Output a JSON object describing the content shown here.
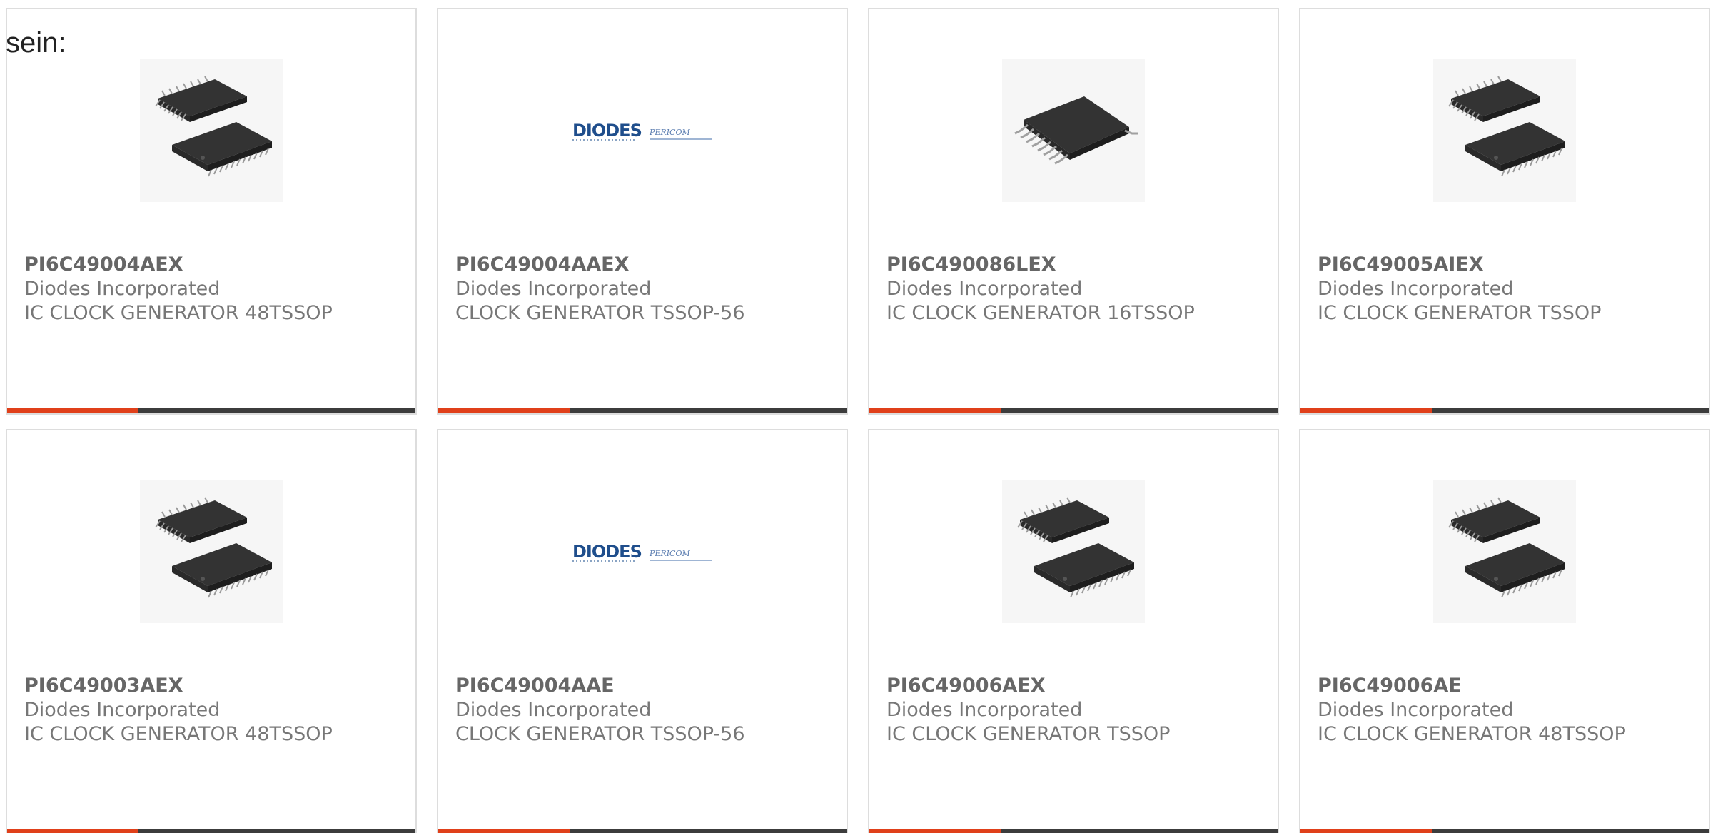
{
  "intro": {
    "text": "sein:"
  },
  "colors": {
    "accent": "#e0401a",
    "bar": "#3c3c3c",
    "border": "#dddddd",
    "text": "#777777"
  },
  "products": [
    {
      "part": "PI6C49004AEX",
      "manufacturer": "Diodes Incorporated",
      "description": "IC CLOCK GENERATOR 48TSSOP",
      "image": "tssop-48-chip-image"
    },
    {
      "part": "PI6C49004AAEX",
      "manufacturer": "Diodes Incorporated",
      "description": "CLOCK GENERATOR TSSOP-56",
      "image": "diodes-pericom-logo-image",
      "logo_text": "DIODES",
      "logo_subtext": "PERICOM"
    },
    {
      "part": "PI6C490086LEX",
      "manufacturer": "Diodes Incorporated",
      "description": "IC CLOCK GENERATOR 16TSSOP",
      "image": "tssop-16-chip-image"
    },
    {
      "part": "PI6C49005AIEX",
      "manufacturer": "Diodes Incorporated",
      "description": "IC CLOCK GENERATOR TSSOP",
      "image": "tssop-48-chip-image"
    },
    {
      "part": "PI6C49003AEX",
      "manufacturer": "Diodes Incorporated",
      "description": "IC CLOCK GENERATOR 48TSSOP",
      "image": "tssop-48-chip-image"
    },
    {
      "part": "PI6C49004AAE",
      "manufacturer": "Diodes Incorporated",
      "description": "CLOCK GENERATOR TSSOP-56",
      "image": "diodes-pericom-logo-image",
      "logo_text": "DIODES",
      "logo_subtext": "PERICOM"
    },
    {
      "part": "PI6C49006AEX",
      "manufacturer": "Diodes Incorporated",
      "description": "IC CLOCK GENERATOR TSSOP",
      "image": "tssop-48-chip-image"
    },
    {
      "part": "PI6C49006AE",
      "manufacturer": "Diodes Incorporated",
      "description": "IC CLOCK GENERATOR 48TSSOP",
      "image": "tssop-48-chip-image"
    }
  ]
}
